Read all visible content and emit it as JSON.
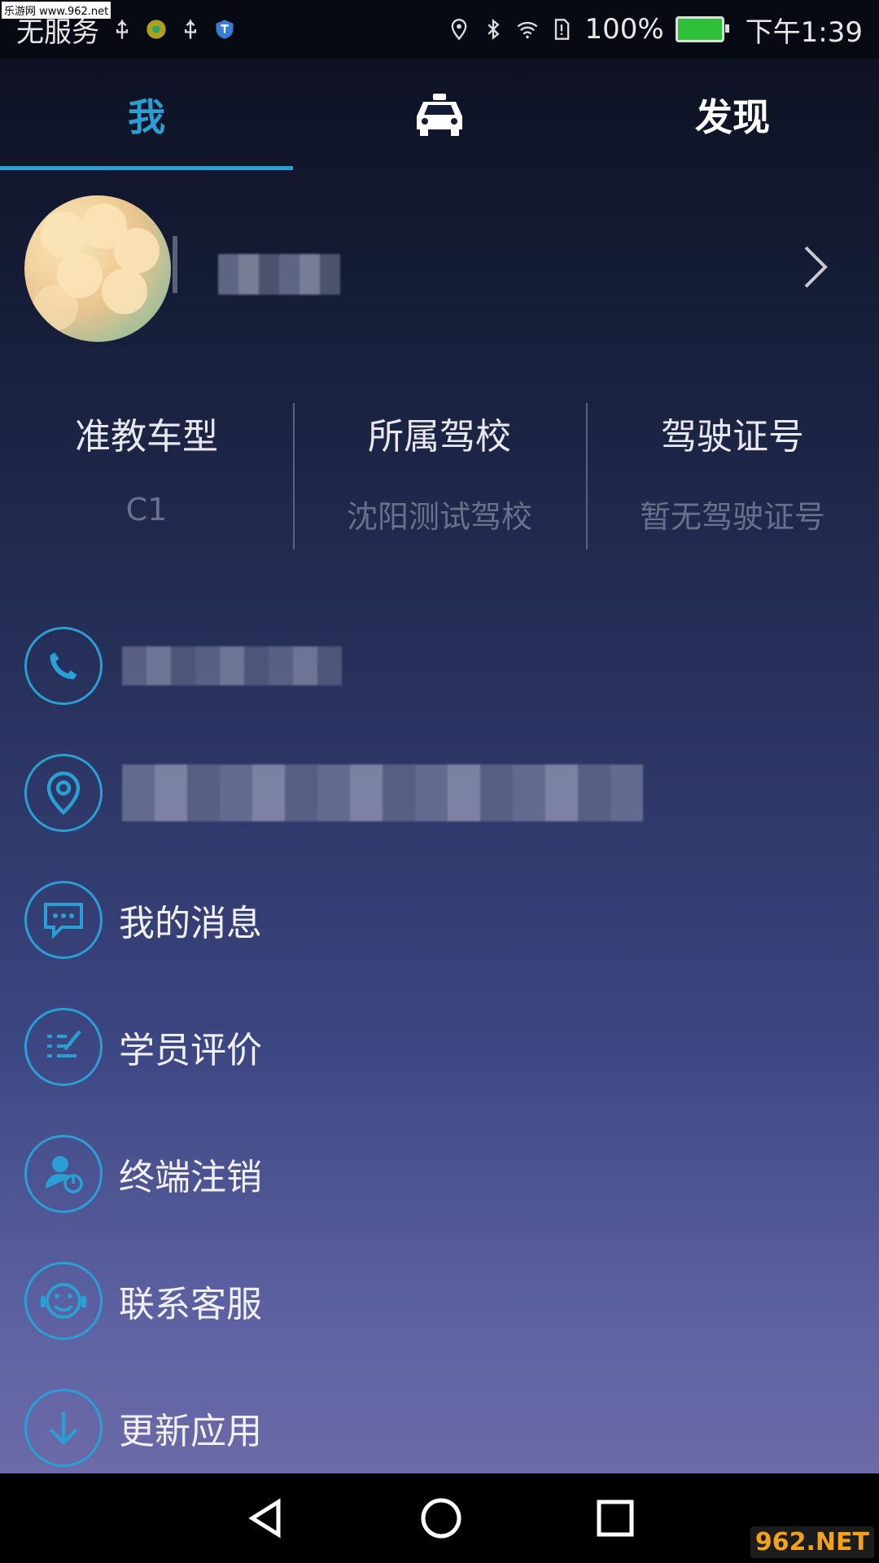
{
  "status": {
    "carrier": "无服务",
    "battery": "100%",
    "time": "下午1:39",
    "watermark": "乐游网 www.962.net"
  },
  "tabs": [
    {
      "label": "我",
      "active": true
    },
    {
      "icon": "car-icon",
      "active": false
    },
    {
      "label": "发现",
      "active": false
    }
  ],
  "info": [
    {
      "title": "准教车型",
      "value": "C1"
    },
    {
      "title": "所属驾校",
      "value": "沈阳测试驾校"
    },
    {
      "title": "驾驶证号",
      "value": "暂无驾驶证号"
    }
  ],
  "menu": [
    {
      "icon": "phone-icon"
    },
    {
      "icon": "location-icon"
    },
    {
      "icon": "message-icon",
      "label": "我的消息"
    },
    {
      "icon": "review-icon",
      "label": "学员评价"
    },
    {
      "icon": "logout-user-icon",
      "label": "终端注销"
    },
    {
      "icon": "customer-service-icon",
      "label": "联系客服"
    },
    {
      "icon": "download-icon",
      "label": "更新应用"
    }
  ],
  "colors": {
    "accent": "#2a9fd4"
  },
  "watermark_logo": "962.NET"
}
